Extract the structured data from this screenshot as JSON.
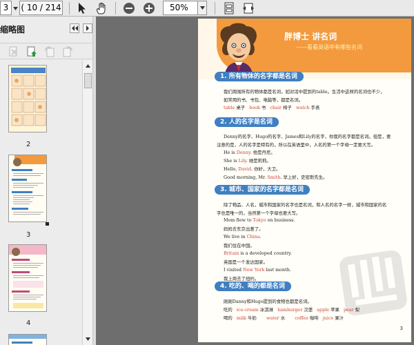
{
  "toolbar": {
    "current_page": "3",
    "page_count": "( 10 / 214 )",
    "zoom": "50%"
  },
  "sidebar": {
    "title": "缩略图",
    "thumb_labels": [
      "2",
      "3",
      "4"
    ]
  },
  "page": {
    "hero_title": "胖博士 讲名词",
    "hero_subtitle": "——看看英语中有哪些名词",
    "sections": [
      {
        "heading": "1. 所有物体的名字都是名词",
        "lines": [
          "我们周围所有的物体都是名词，如对话中提到的table。生活中这样的名词也不少，",
          "如常用的书、书包、电脑等，都是名词。"
        ],
        "vocab": [
          {
            "en": "table",
            "zh": "桌子"
          },
          {
            "en": "book",
            "zh": "书"
          },
          {
            "en": "chair",
            "zh": "椅子"
          },
          {
            "en": "watch",
            "zh": "手表"
          }
        ]
      },
      {
        "heading": "2. 人的名字是名词",
        "lines": [
          "Denny的名字、Hugo的名字、James和Lily的名字，你我的名字都是名词。但是，要",
          "注意的是，人的名字是特有的，所以在英语里中，人名的第一个字母一定要大写。"
        ],
        "examples": [
          {
            "pre": "He is ",
            "name": "Denny",
            "post": ". 他是丹尼。"
          },
          {
            "pre": "She is ",
            "name": "Lily",
            "post": ". 她是莉莉。"
          },
          {
            "pre": "Hello, ",
            "name": "David",
            "post": ". 你好，大卫。"
          },
          {
            "pre": "Good morning, Mr. ",
            "name": "Smith",
            "post": ". 早上好，史密斯先生。"
          }
        ]
      },
      {
        "heading": "3. 城市、国家的名字都是名词",
        "lines": [
          "除了物品、人名，城市和国家的名字也是名词，和人名的名字一样，城市和国家的名",
          "字也是唯一的，当然第一个字母也要大写。"
        ],
        "examples": [
          {
            "pre": "Mom flew to ",
            "name": "Tokyo",
            "post": " on business."
          },
          {
            "pre": "妈妈去东京出差了。",
            "name": "",
            "post": ""
          },
          {
            "pre": "We live in ",
            "name": "China",
            "post": "."
          },
          {
            "pre": "我们住在中国。",
            "name": "",
            "post": ""
          },
          {
            "pre": "",
            "name": "Britain",
            "post": " is a developed country."
          },
          {
            "pre": "英国是一个发达国家。",
            "name": "",
            "post": ""
          },
          {
            "pre": "I visited ",
            "name": "New York",
            "post": " last month."
          },
          {
            "pre": "我上周去了纽约。",
            "name": "",
            "post": ""
          }
        ]
      },
      {
        "heading": "4. 吃的、喝的都是名词",
        "lines": [
          "刚刚Danny和Hugo提到的食物也都是名词。"
        ],
        "eat_label": "吃的",
        "eat": [
          {
            "en": "ice-cream",
            "zh": "冰淇淋"
          },
          {
            "en": "hamburger",
            "zh": "汉堡"
          },
          {
            "en": "apple",
            "zh": "苹果"
          },
          {
            "en": "pear",
            "zh": "梨"
          }
        ],
        "drink_label": "喝的",
        "drink": [
          {
            "en": "milk",
            "zh": "牛奶"
          },
          {
            "en": "water",
            "zh": "水"
          },
          {
            "en": "coffee",
            "zh": "咖啡"
          },
          {
            "en": "juice",
            "zh": "果汁"
          }
        ]
      }
    ],
    "page_number": "3"
  },
  "colors": {
    "heading_blue": "#3f7fc2",
    "hero_orange": "#f39a3e",
    "highlight_red": "#d0433c"
  }
}
